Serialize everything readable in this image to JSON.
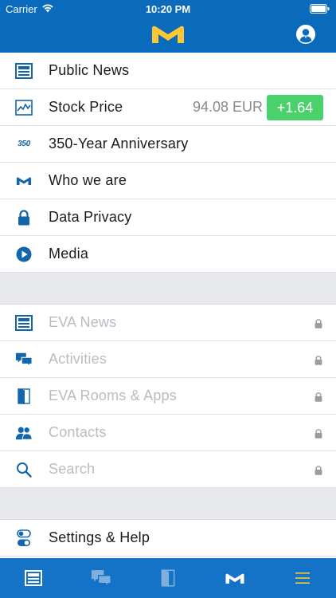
{
  "status_bar": {
    "carrier": "Carrier",
    "time": "10:20 PM"
  },
  "header": {
    "logo_icon": "m-logo-icon",
    "profile_icon": "user-profile-icon"
  },
  "menu": {
    "primary": [
      {
        "id": "public-news",
        "label": "Public News",
        "icon": "newspaper-icon"
      },
      {
        "id": "stock-price",
        "label": "Stock Price",
        "icon": "chart-icon",
        "value": "94.08 EUR",
        "change": "+1.64"
      },
      {
        "id": "anniversary",
        "label": "350-Year Anniversary",
        "icon": "350-icon",
        "icon_text": "350"
      },
      {
        "id": "who-we-are",
        "label": "Who we are",
        "icon": "m-logo-icon"
      },
      {
        "id": "data-privacy",
        "label": "Data Privacy",
        "icon": "lock-icon"
      },
      {
        "id": "media",
        "label": "Media",
        "icon": "play-icon"
      }
    ],
    "restricted": [
      {
        "id": "eva-news",
        "label": "EVA News",
        "icon": "newspaper-icon"
      },
      {
        "id": "activities",
        "label": "Activities",
        "icon": "chat-bubbles-icon"
      },
      {
        "id": "eva-rooms-apps",
        "label": "EVA Rooms & Apps",
        "icon": "door-icon"
      },
      {
        "id": "contacts",
        "label": "Contacts",
        "icon": "people-icon"
      },
      {
        "id": "search",
        "label": "Search",
        "icon": "search-icon"
      }
    ],
    "settings": [
      {
        "id": "settings-help",
        "label": "Settings & Help",
        "icon": "toggle-icon"
      }
    ]
  },
  "tabbar": {
    "tabs": [
      {
        "id": "news",
        "icon": "newspaper-icon",
        "active": true
      },
      {
        "id": "activities",
        "icon": "chat-bubbles-icon",
        "active": false
      },
      {
        "id": "rooms",
        "icon": "door-icon",
        "active": false
      },
      {
        "id": "home",
        "icon": "m-logo-icon",
        "active": true
      },
      {
        "id": "menu",
        "icon": "hamburger-menu-icon",
        "active": false
      }
    ]
  },
  "colors": {
    "brand_blue": "#0a6bbd",
    "tabbar_blue": "#1473c6",
    "logo_yellow": "#ffc832",
    "positive_green": "#4bd16b",
    "disabled_text": "#b9bcc2"
  }
}
